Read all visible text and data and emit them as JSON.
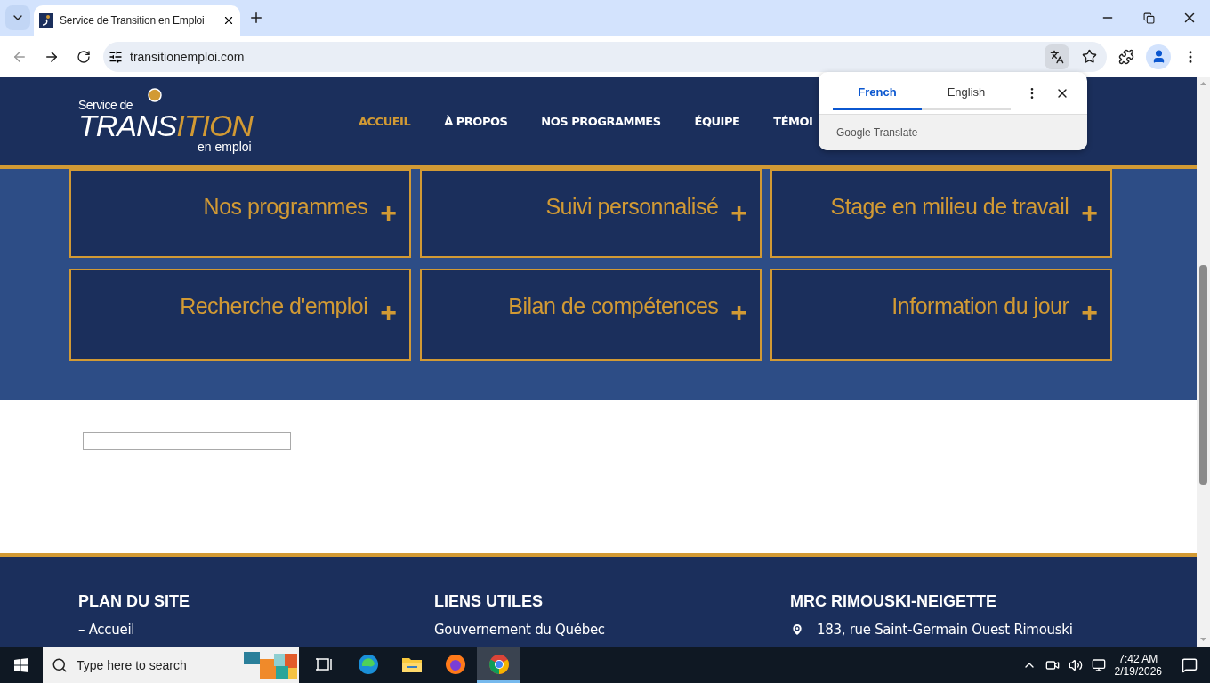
{
  "browser": {
    "tabs": [
      {
        "title": "Service de Transition en Emploi",
        "selected": true
      }
    ],
    "address": "transitionemploi.com"
  },
  "translate_popup": {
    "languages": [
      {
        "label": "French",
        "selected": true
      },
      {
        "label": "English",
        "selected": false
      }
    ],
    "brand": "Google Translate"
  },
  "site": {
    "logo": {
      "line1": "Service de",
      "word_a": "TRANS",
      "word_b": "ITION",
      "line3": "en emploi"
    },
    "nav": [
      {
        "label": "ACCUEIL",
        "selected": true
      },
      {
        "label": "À PROPOS",
        "selected": false
      },
      {
        "label": "NOS PROGRAMMES",
        "selected": false
      },
      {
        "label": "ÉQUIPE",
        "selected": false
      },
      {
        "label": "TÉMOI",
        "selected": false
      }
    ]
  },
  "cards": [
    {
      "title": "Nos programmes",
      "symbol": "+"
    },
    {
      "title": "Suivi personnalisé",
      "symbol": "+"
    },
    {
      "title": "Stage en milieu de travail",
      "symbol": "+"
    },
    {
      "title": "Recherche d'emploi",
      "symbol": "+"
    },
    {
      "title": "Bilan de compétences",
      "symbol": "+"
    },
    {
      "title": "Information du jour",
      "symbol": "+"
    }
  ],
  "footer": {
    "columns": [
      {
        "heading": "PLAN DU SITE",
        "items": [
          {
            "kind": "link",
            "text": "– Accueil"
          }
        ]
      },
      {
        "heading": "LIENS UTILES",
        "items": [
          {
            "kind": "link",
            "text": "Gouvernement du Québec"
          }
        ]
      },
      {
        "heading": "MRC RIMOUSKI-NEIGETTE",
        "items": [
          {
            "kind": "address",
            "text": "183, rue Saint-Germain Ouest Rimouski"
          }
        ]
      }
    ]
  },
  "taskbar": {
    "search_placeholder": "Type here to search",
    "apps": [
      {
        "kind": "taskview",
        "selected": false
      },
      {
        "kind": "edge",
        "selected": false
      },
      {
        "kind": "explorer",
        "selected": false
      },
      {
        "kind": "firefox",
        "selected": false
      },
      {
        "kind": "chrome",
        "selected": true
      }
    ],
    "time": "7:42 AM",
    "date": "2/19/2026"
  }
}
